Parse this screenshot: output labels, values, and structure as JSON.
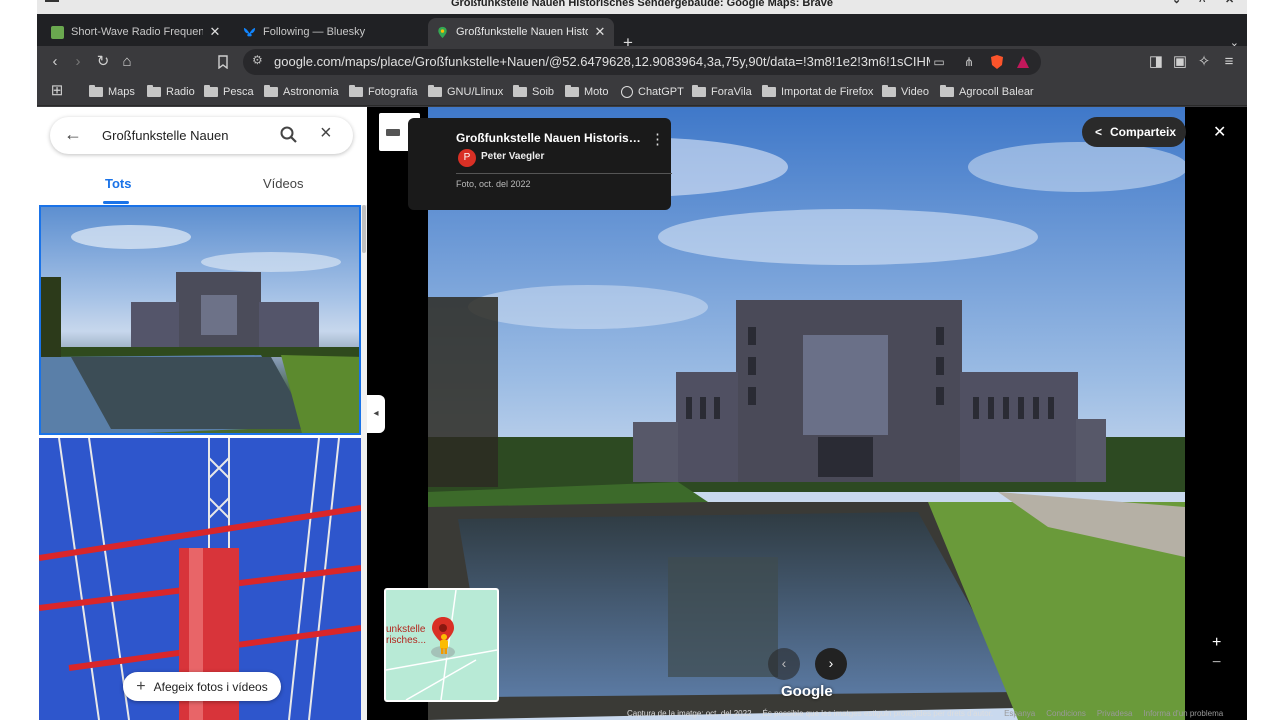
{
  "window": {
    "title": "Großfunkstelle Nauen Historisches Sendergebäude: Google Maps: Brave"
  },
  "tabs": [
    {
      "label": "Short-Wave Radio Frequency",
      "favicon_color": "#6aa84f",
      "active": false
    },
    {
      "label": "Following — Bluesky",
      "favicon_color": "#1185fe",
      "active": false
    },
    {
      "label": "Großfunkstelle Nauen Historisc",
      "favicon_color": "#34a853",
      "active": true
    }
  ],
  "toolbar": {
    "url": "google.com/maps/place/Großfunkstelle+Nauen/@52.6479628,12.9083964,3a,75y,90t/data=!3m8!1e2!3m6!1sCIHM0ogK..."
  },
  "bookmarks": [
    {
      "label": "Maps",
      "icon": "folder-icon"
    },
    {
      "label": "Radio",
      "icon": "folder-icon"
    },
    {
      "label": "Pesca",
      "icon": "folder-icon"
    },
    {
      "label": "Astronomia",
      "icon": "folder-icon"
    },
    {
      "label": "Fotografia",
      "icon": "folder-icon"
    },
    {
      "label": "GNU/Llinux",
      "icon": "folder-icon"
    },
    {
      "label": "Soib",
      "icon": "folder-icon"
    },
    {
      "label": "Moto",
      "icon": "folder-icon"
    },
    {
      "label": "ChatGPT",
      "icon": "chatgpt-icon"
    },
    {
      "label": "ForaVila",
      "icon": "folder-icon"
    },
    {
      "label": "Importat de Firefox",
      "icon": "folder-icon"
    },
    {
      "label": "Video",
      "icon": "folder-icon"
    },
    {
      "label": "Agrocoll Balear",
      "icon": "folder-icon"
    }
  ],
  "sidepanel": {
    "search_query": "Großfunkstelle Nauen",
    "tabs": [
      "Tots",
      "Vídeos"
    ],
    "add_photos_label": "Afegeix fotos i vídeos"
  },
  "viewer": {
    "photo_title": "Großfunkstelle Nauen Historisches ...",
    "author_initial": "P",
    "author_name": "Peter Vaegler",
    "photo_date": "Foto, oct. del 2022",
    "share_label": "Comparteix",
    "minimap_label_line1": "unkstelle",
    "minimap_label_line2": "risches...",
    "logo": "Google",
    "zoom_in": "+",
    "zoom_out": "−"
  },
  "footer": {
    "capture_date": "Captura de la imatge: oct. del 2022",
    "copyright_notice": "És possible que les imatges estiguin protegides per drets d'autor.",
    "country": "Espanya",
    "terms": "Condicions",
    "privacy": "Privadesa",
    "report": "Informa d'un problema"
  },
  "colors": {
    "accent": "#1a73e8",
    "pin": "#d93025",
    "browser_dark": "#3a3a3d"
  }
}
